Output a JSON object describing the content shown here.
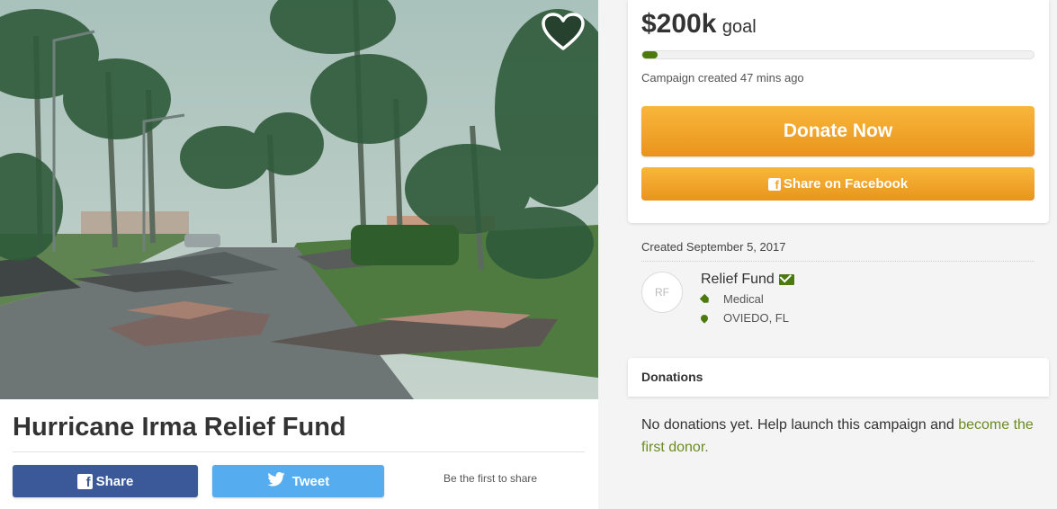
{
  "hero": {
    "image_alt": "Hurricane damaged street with palm trees and torn roofing",
    "favorite_icon": "heart-outline-icon"
  },
  "campaign": {
    "title": "Hurricane Irma Relief Fund",
    "goal_amount": "$200k",
    "goal_word": "goal",
    "progress_fraction": 0.04,
    "created_ago": "Campaign created 47 mins ago",
    "created_date": "Created September 5, 2017"
  },
  "share": {
    "facebook_label": "Share",
    "tweet_label": "Tweet",
    "first_to_share": "Be the first to share",
    "facebook_icon": "facebook-icon",
    "twitter_icon": "twitter-bird-icon"
  },
  "actions": {
    "donate_label": "Donate Now",
    "share_facebook_label": "Share on Facebook"
  },
  "organizer": {
    "initials": "RF",
    "name": "Relief Fund",
    "category": "Medical",
    "location": "OVIEDO, FL",
    "verified_icon": "envelope-icon",
    "category_icon": "tag-icon",
    "location_icon": "map-pin-icon"
  },
  "donations": {
    "header": "Donations",
    "empty_text": "No donations yet. Help launch this campaign and ",
    "empty_link": "become the first donor."
  },
  "colors": {
    "accent_green": "#4c7a0f",
    "donate_orange": "#eea626",
    "facebook_blue": "#3b5998",
    "twitter_blue": "#55acee"
  }
}
